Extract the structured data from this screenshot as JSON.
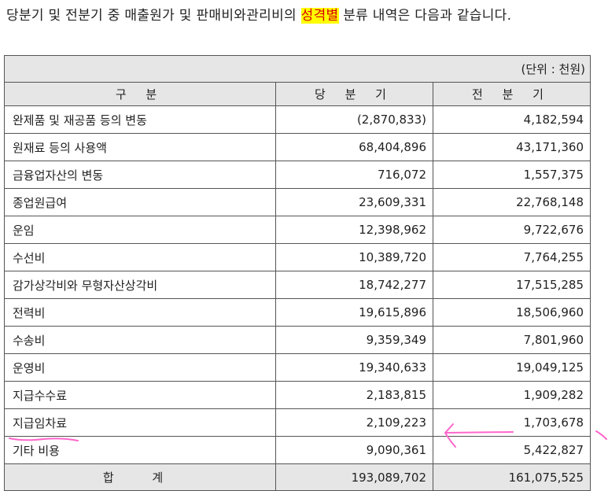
{
  "intro": {
    "before": "당분기 및 전분기 중 매출원가 및 판매비와관리비의 ",
    "highlight": "성격별",
    "after": " 분류 내역은 다음과 같습니다."
  },
  "table": {
    "unit": "(단위 : 천원)",
    "headers": [
      "구 분",
      "당 분 기",
      "전 분 기"
    ],
    "rows": [
      {
        "label": "완제품 및 재공품 등의 변동",
        "current": "(2,870,833)",
        "prior": "4,182,594"
      },
      {
        "label": "원재료 등의 사용액",
        "current": "68,404,896",
        "prior": "43,171,360"
      },
      {
        "label": "금융업자산의 변동",
        "current": "716,072",
        "prior": "1,557,375"
      },
      {
        "label": "종업원급여",
        "current": "23,609,331",
        "prior": "22,768,148"
      },
      {
        "label": "운임",
        "current": "12,398,962",
        "prior": "9,722,676"
      },
      {
        "label": "수선비",
        "current": "10,389,720",
        "prior": "7,764,255"
      },
      {
        "label": "감가상각비와 무형자산상각비",
        "current": "18,742,277",
        "prior": "17,515,285"
      },
      {
        "label": "전력비",
        "current": "19,615,896",
        "prior": "18,506,960"
      },
      {
        "label": "수송비",
        "current": "9,359,349",
        "prior": "7,801,960"
      },
      {
        "label": "운영비",
        "current": "19,340,633",
        "prior": "19,049,125"
      },
      {
        "label": "지급수수료",
        "current": "2,183,815",
        "prior": "1,909,282"
      },
      {
        "label": "지급임차료",
        "current": "2,109,223",
        "prior": "1,703,678"
      },
      {
        "label": "기타 비용",
        "current": "9,090,361",
        "prior": "5,422,827"
      }
    ],
    "total": {
      "label": "합 계",
      "current": "193,089,702",
      "prior": "161,075,525"
    }
  },
  "colors": {
    "highlight_bg": "#ffff00",
    "highlight_text": "#d80000",
    "header_bg": "#e6e6e6",
    "annotation": "#ff66cc"
  }
}
